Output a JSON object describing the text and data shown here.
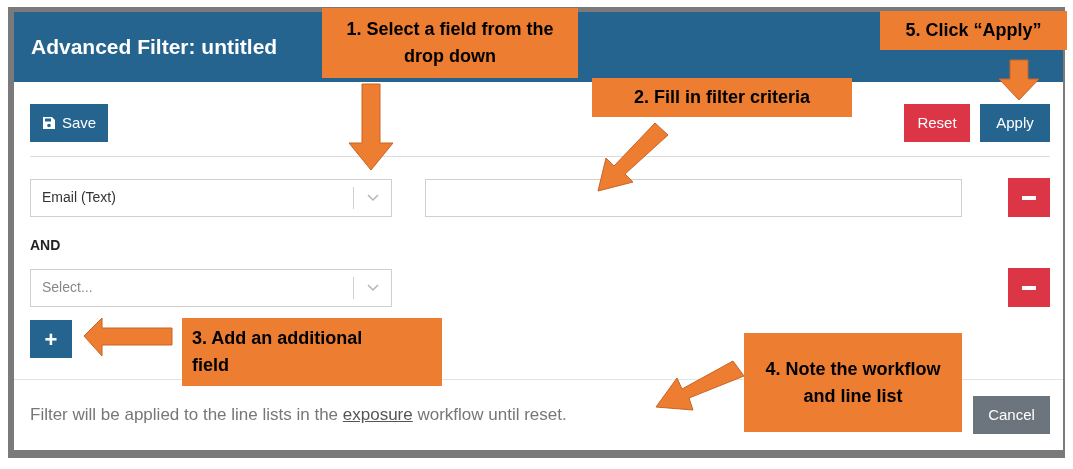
{
  "dialog": {
    "title": "Advanced Filter: untitled",
    "save_button": "Save",
    "reset_button": "Reset",
    "apply_button": "Apply",
    "rules": [
      {
        "field_value": "Email (Text)",
        "has_criteria": true
      },
      {
        "connector": "AND",
        "field_placeholder": "Select...",
        "has_criteria": false
      }
    ],
    "add_button": "+",
    "note": {
      "before": "Filter will be applied to the line lists in the ",
      "link": "exposure",
      "after": " workflow until reset."
    },
    "cancel_button": "Cancel"
  },
  "callouts": [
    {
      "text": "1. Select a field from the drop down"
    },
    {
      "text": "2. Fill in filter criteria"
    },
    {
      "text": "3. Add an additional field"
    },
    {
      "text": "4. Note the workflow and line list"
    },
    {
      "text": "5. Click “Apply”"
    }
  ]
}
